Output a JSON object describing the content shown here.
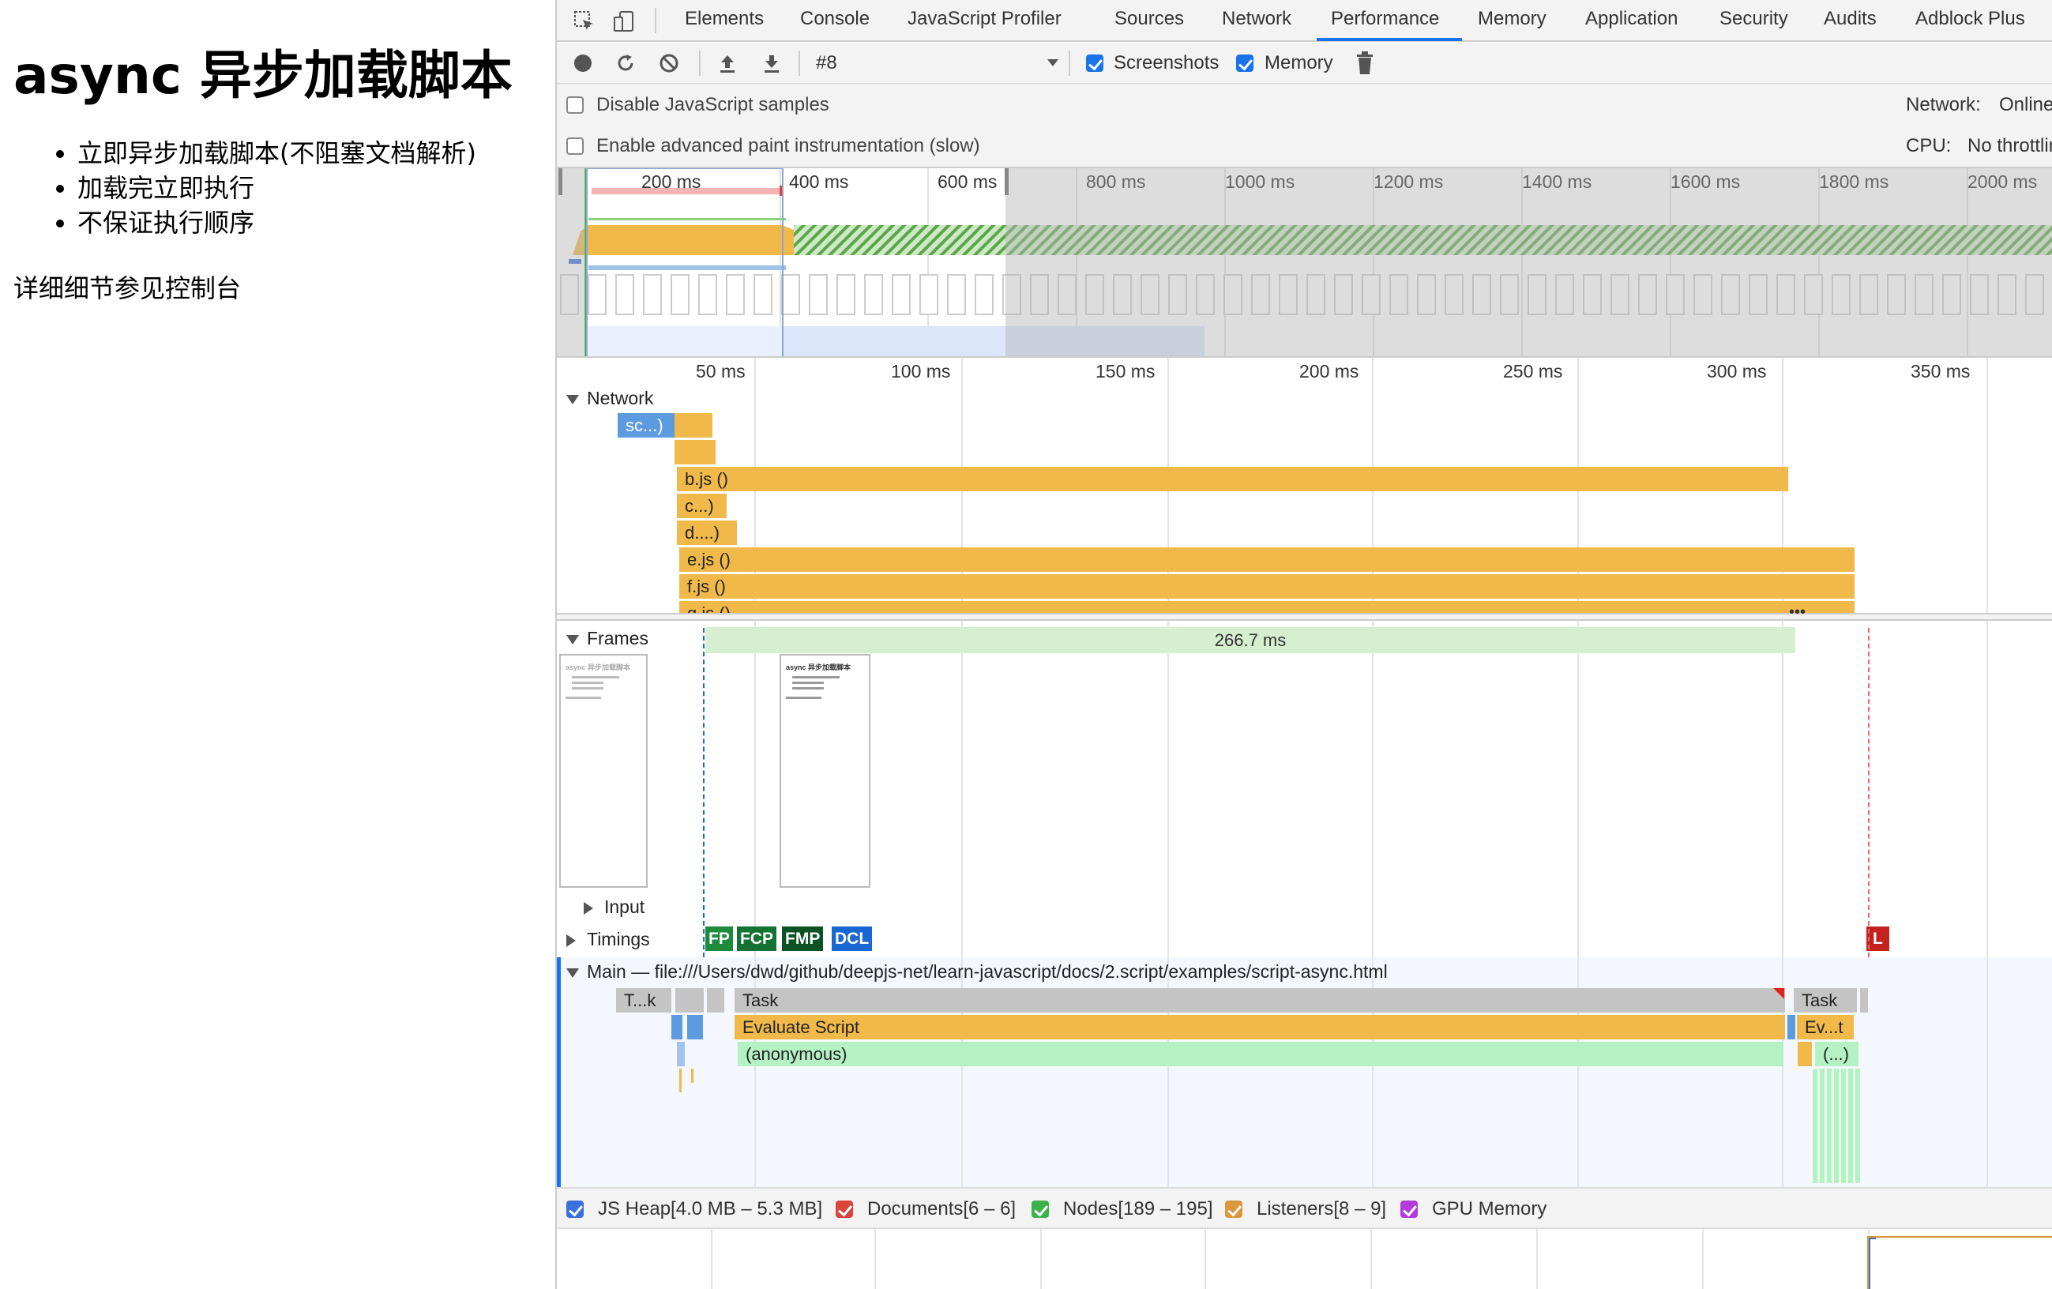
{
  "page": {
    "title": "async 异步加载脚本",
    "bullets": [
      "立即异步加载脚本(不阻塞文档解析)",
      "加载完立即执行",
      "不保证执行顺序"
    ],
    "note": "详细细节参见控制台"
  },
  "devtools": {
    "tabs": [
      "Elements",
      "Console",
      "JavaScript Profiler",
      "Sources",
      "Network",
      "Performance",
      "Memory",
      "Application",
      "Security",
      "Audits",
      "Adblock Plus"
    ],
    "active_tab": "Performance",
    "toolbar": {
      "recording_select": "#8",
      "screenshots_label": "Screenshots",
      "memory_label": "Memory"
    },
    "settings": {
      "disable_js_samples": "Disable JavaScript samples",
      "advanced_paint": "Enable advanced paint instrumentation (slow)",
      "network_label": "Network:",
      "network_value": "Online",
      "cpu_label": "CPU:",
      "cpu_value": "No throttlin"
    },
    "overview_ticks": [
      "200 ms",
      "400 ms",
      "600 ms",
      "800 ms",
      "1000 ms",
      "1200 ms",
      "1400 ms",
      "1600 ms",
      "1800 ms",
      "2000 ms"
    ],
    "detail_ticks": [
      "50 ms",
      "100 ms",
      "150 ms",
      "200 ms",
      "250 ms",
      "300 ms",
      "350 ms"
    ],
    "network": {
      "header": "Network",
      "requests": [
        "sc...)",
        "",
        "b.js ()",
        "c...)",
        "d....)",
        "e.js ()",
        "f.js ()",
        "g.js ()"
      ]
    },
    "frames": {
      "header": "Frames",
      "duration": "266.7 ms",
      "thumb_title": "async 异步加载脚本"
    },
    "input_header": "Input",
    "timings": {
      "header": "Timings",
      "markers": [
        "FP",
        "FCP",
        "FMP",
        "DCL",
        "L"
      ]
    },
    "main": {
      "header": "Main — file:///Users/dwd/github/deepjs-net/learn-javascript/docs/2.script/examples/script-async.html",
      "task_short": "T...k",
      "task": "Task",
      "task2": "Task",
      "evaluate": "Evaluate Script",
      "evaluate_short": "Ev...t",
      "anonymous": "(anonymous)",
      "anon_short": "(...)"
    },
    "memory_legend": [
      {
        "label": "JS Heap[4.0 MB – 5.3 MB]",
        "color": "#3b6fd9"
      },
      {
        "label": "Documents[6 – 6]",
        "color": "#d9453b"
      },
      {
        "label": "Nodes[189 – 195]",
        "color": "#3bb34a"
      },
      {
        "label": "Listeners[8 – 9]",
        "color": "#d9983b"
      },
      {
        "label": "GPU Memory",
        "color": "#b33bd9"
      }
    ]
  }
}
